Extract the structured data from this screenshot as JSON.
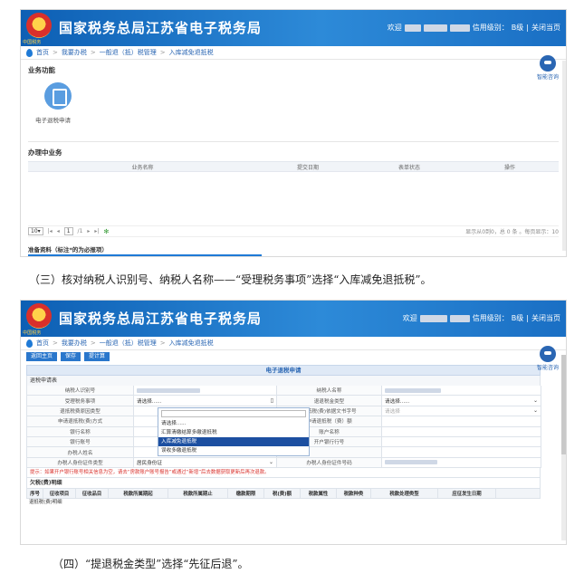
{
  "common": {
    "site_title": "国家税务总局江苏省电子税务局",
    "emblem_text": "中国税务",
    "welcome": "欢迎",
    "credit_label": "信用级别：",
    "credit_value": "B级",
    "close_link": "关闭当页",
    "assistant_label": "智能咨询",
    "breadcrumb": [
      "首页",
      "我要办税",
      "一般退（抵）税管理",
      "入库减免退抵税"
    ],
    "breadcrumb_sep": ">"
  },
  "shot1": {
    "section_business": "业务功能",
    "function_item": "电子退税申请",
    "section_pending": "办理中业务",
    "task_columns": [
      "业务名称",
      "提交日期",
      "表单状态",
      "操作"
    ],
    "pager": {
      "page_size": "10",
      "page_size_caret": "▾",
      "first": "|◂",
      "prev": "◂",
      "current": "1",
      "total": "/1",
      "next": "▸",
      "last": "▸|",
      "refresh_icon": "✻",
      "info": "显示从0到0，总 0 条 。每页显示：10"
    },
    "prep_title": "准备资料（标注*的为必报项）"
  },
  "caption1": "（三）核对纳税人识别号、纳税人名称——“受理税务事项”选择“入库减免退抵税”。",
  "shot2": {
    "buttons": [
      "返回主页",
      "保存",
      "提计算"
    ],
    "form_title": "电子退税申请",
    "sub_title": "退税申请表",
    "rows": [
      {
        "l1": "纳税人识别号",
        "v1": "",
        "l2": "纳税人名称",
        "v2": ""
      },
      {
        "l1": "受理税务事项",
        "v1": "请选择......",
        "l2": "退退税金类型",
        "v2": "请选择......"
      },
      {
        "l1": "退抵税费原因类型",
        "v1": "",
        "l2": "退抵税(费)依据文书字号",
        "v2": "请选择"
      },
      {
        "l1": "申请退抵税(费)方式",
        "v1": "",
        "l2": "申请退抵税（费）额",
        "v2": ""
      },
      {
        "l1": "银行名称",
        "v1": "",
        "l2": "账户名称",
        "v2": ""
      },
      {
        "l1": "银行账号",
        "v1": "",
        "l2": "开户银行行号",
        "v2": ""
      },
      {
        "l1": "办税人姓名",
        "v1": "",
        "l2": "",
        "v2": ""
      },
      {
        "l1": "办税人身份证件类型",
        "v1": "居民身份证",
        "l2": "办税人身份证件号码",
        "v2": ""
      }
    ],
    "dropdown_options": [
      "请选择......",
      "汇算清缴结算多缴退抵税",
      "入库减免退抵税",
      "误收多缴退抵税"
    ],
    "dropdown_active_index": 2,
    "notice": "提示：如果开户银行账号相关信息为空，请去“房款账户账号报告”或通过“新增”后去数据获取更新后再次退款。",
    "detail_title": "欠税(费)明细",
    "detail_columns": [
      "序号",
      "征收项目",
      "征收品目",
      "税款所属期起",
      "税款所属期止",
      "缴款期限",
      "税(费)额",
      "税款属性",
      "税款种类",
      "税款处理类型",
      "应征发生日期"
    ],
    "detail_footer": "退抵税(费)明细"
  },
  "caption2": "（四）“提退税金类型”选择“先征后退”。"
}
